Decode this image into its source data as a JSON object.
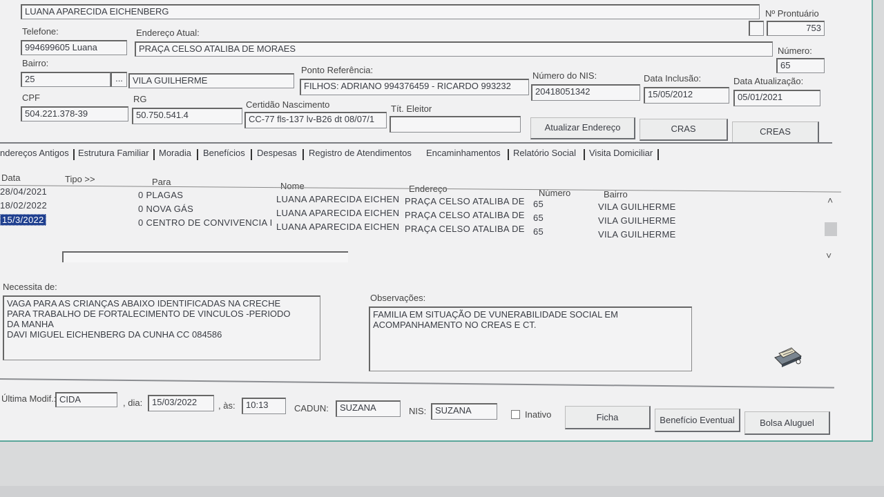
{
  "header": {
    "name_value": "LUANA APARECIDA EICHENBERG",
    "prontuario_label": "Nº Prontuário",
    "prontuario_value": "753"
  },
  "contact": {
    "telefone_label": "Telefone:",
    "telefone_value": "994699605 Luana",
    "endereco_label": "Endereço Atual:",
    "endereco_value": "PRAÇA CELSO ATALIBA DE MORAES",
    "numero_label": "Número:",
    "numero_value": "65",
    "bairro_label": "Bairro:",
    "bairro_code": "25",
    "bairro_browse": "...",
    "bairro_value": "VILA GUILHERME",
    "ponto_label": "Ponto Referência:",
    "ponto_value": "FILHOS: ADRIANO 994376459 - RICARDO 993232",
    "nis_label": "Número do NIS:",
    "nis_value": "20418051342",
    "inclusao_label": "Data Inclusão:",
    "inclusao_value": "15/05/2012",
    "atualizacao_label": "Data Atualização:",
    "atualizacao_value": "05/01/2021",
    "cpf_label": "CPF",
    "cpf_value": "504.221.378-39",
    "rg_label": "RG",
    "rg_value": "50.750.541.4",
    "certidao_label": "Certidão Nascimento",
    "certidao_value": "CC-77 fls-137 lv-B26 dt 08/07/1",
    "titulo_label": "Tít. Eleitor",
    "titulo_value": ""
  },
  "actions": {
    "atualizar_label": "Atualizar Endereço",
    "cras_label": "CRAS",
    "creas_label": "CREAS"
  },
  "tabs": [
    "ndereços Antigos",
    "Estrutura Familiar",
    "Moradia",
    "Benefícios",
    "Despesas",
    "Registro de Atendimentos",
    "Encaminhamentos",
    "Relatório Social",
    "Visita Domiciliar"
  ],
  "grid": {
    "headers": {
      "data": "Data",
      "tipo": "Tipo >>",
      "para": "Para",
      "nome": "Nome",
      "endereco": "Endereço",
      "numero": "Número",
      "bairro": "Bairro"
    },
    "rows": [
      {
        "data": "28/04/2021",
        "para": "0 PLAGAS",
        "nome": "LUANA APARECIDA EICHEN",
        "endereco": "PRAÇA CELSO ATALIBA DE",
        "numero": "65",
        "bairro": "VILA GUILHERME"
      },
      {
        "data": "18/02/2022",
        "para": "0 NOVA GÁS",
        "nome": "LUANA APARECIDA EICHEN",
        "endereco": "PRAÇA CELSO ATALIBA DE",
        "numero": "65",
        "bairro": "VILA GUILHERME"
      },
      {
        "data": "15/3/2022",
        "para": "0 CENTRO DE CONVIVENCIA I",
        "nome": "LUANA APARECIDA EICHEN",
        "endereco": "PRAÇA CELSO ATALIBA DE",
        "numero": "65",
        "bairro": "VILA GUILHERME"
      }
    ]
  },
  "necessita": {
    "label": "Necessita de:",
    "lines": [
      "VAGA PARA AS CRIANÇAS ABAIXO IDENTIFICADAS NA CRECHE",
      "PARA TRABALHO DE FORTALECIMENTO DE VINCULOS -PERIODO",
      "DA MANHA",
      "DAVI MIGUEL EICHENBERG DA CUNHA CC 084586"
    ]
  },
  "observacoes": {
    "label": "Observações:",
    "lines": [
      "FAMILIA EM SITUAÇÃO DE VUNERABILIDADE SOCIAL EM",
      "ACOMPANHAMENTO NO CREAS E CT."
    ]
  },
  "footer": {
    "ultima_label": "Última Modif.:",
    "ultima_value": "CIDA",
    "dia_label": ", dia:",
    "dia_value": "15/03/2022",
    "as_label": ", às:",
    "as_value": "10:13",
    "cadun_label": "CADUN:",
    "cadun_value": "SUZANA",
    "nis_label": "NIS:",
    "nis_value": "SUZANA",
    "inativo_label": "Inativo",
    "ficha_label": "Ficha",
    "beneficio_label": "Benefício Eventual",
    "bolsa_label": "Bolsa Aluguel"
  }
}
